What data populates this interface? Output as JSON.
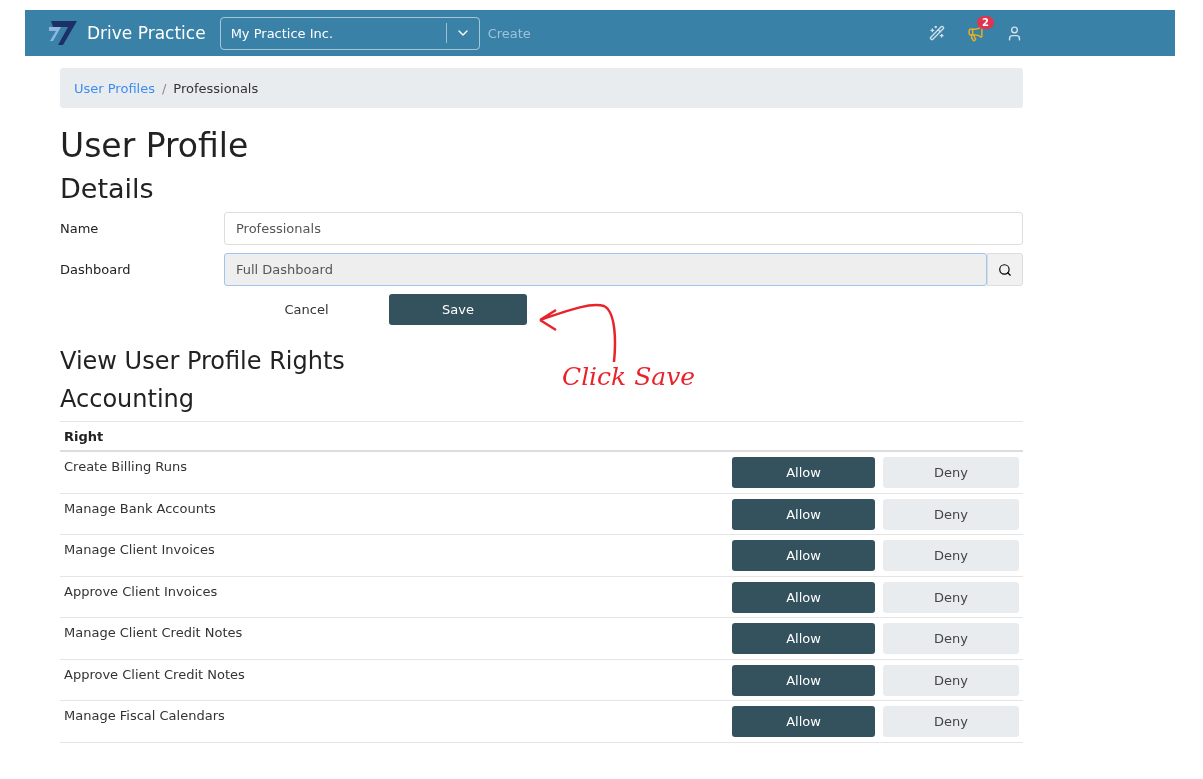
{
  "navbar": {
    "brand": "Drive Practice",
    "practice_select": {
      "value": "My Practice Inc."
    },
    "create_link": "Create",
    "notification_count": "2"
  },
  "breadcrumb": [
    {
      "label": "User Profiles",
      "link": true
    },
    {
      "label": "Professionals",
      "link": false
    }
  ],
  "breadcrumb_separator": "/",
  "title": "User Profile",
  "details": {
    "heading": "Details",
    "fields": [
      {
        "label": "Name",
        "value": "Professionals",
        "kind": "text"
      },
      {
        "label": "Dashboard",
        "value": "Full Dashboard",
        "kind": "lookup"
      }
    ],
    "buttons": {
      "cancel": "Cancel",
      "save": "Save"
    }
  },
  "annotation": "Click Save",
  "rights_heading": "View User Profile Rights",
  "section": "Accounting",
  "table": {
    "column": "Right",
    "rows": [
      {
        "right": "Create Billing Runs",
        "allow": "Allow",
        "deny": "Deny",
        "allowed": true
      },
      {
        "right": "Manage Bank Accounts",
        "allow": "Allow",
        "deny": "Deny",
        "allowed": true
      },
      {
        "right": "Manage Client Invoices",
        "allow": "Allow",
        "deny": "Deny",
        "allowed": true
      },
      {
        "right": "Approve Client Invoices",
        "allow": "Allow",
        "deny": "Deny",
        "allowed": true
      },
      {
        "right": "Manage Client Credit Notes",
        "allow": "Allow",
        "deny": "Deny",
        "allowed": true
      },
      {
        "right": "Approve Client Credit Notes",
        "allow": "Allow",
        "deny": "Deny",
        "allowed": true
      },
      {
        "right": "Manage Fiscal Calendars",
        "allow": "Allow",
        "deny": "Deny",
        "allowed": true
      }
    ]
  }
}
